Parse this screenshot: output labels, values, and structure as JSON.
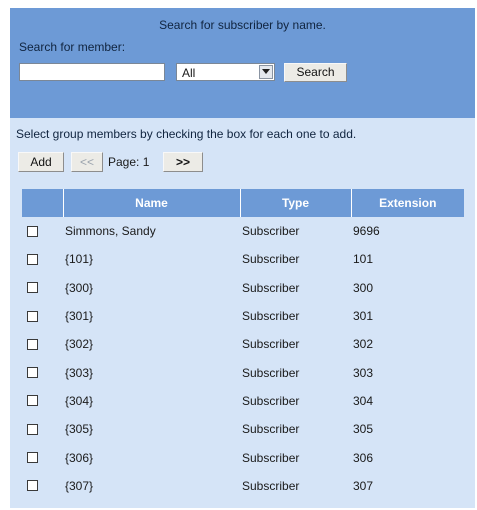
{
  "search": {
    "title": "Search for subscriber by name.",
    "label": "Search for member:",
    "input_value": "",
    "select_value": "All",
    "button_label": "Search"
  },
  "instruction": "Select group members by checking the box for each one to add.",
  "pager": {
    "add_label": "Add",
    "prev_label": "<<",
    "page_text": "Page: 1",
    "next_label": ">>"
  },
  "table": {
    "headers": [
      "",
      "Name",
      "Type",
      "Extension"
    ],
    "rows": [
      {
        "checked": false,
        "name": "Simmons, Sandy",
        "type": "Subscriber",
        "extension": "9696"
      },
      {
        "checked": false,
        "name": "{101}",
        "type": "Subscriber",
        "extension": "101"
      },
      {
        "checked": false,
        "name": "{300}",
        "type": "Subscriber",
        "extension": "300"
      },
      {
        "checked": false,
        "name": "{301}",
        "type": "Subscriber",
        "extension": "301"
      },
      {
        "checked": false,
        "name": "{302}",
        "type": "Subscriber",
        "extension": "302"
      },
      {
        "checked": false,
        "name": "{303}",
        "type": "Subscriber",
        "extension": "303"
      },
      {
        "checked": false,
        "name": "{304}",
        "type": "Subscriber",
        "extension": "304"
      },
      {
        "checked": false,
        "name": "{305}",
        "type": "Subscriber",
        "extension": "305"
      },
      {
        "checked": false,
        "name": "{306}",
        "type": "Subscriber",
        "extension": "306"
      },
      {
        "checked": false,
        "name": "{307}",
        "type": "Subscriber",
        "extension": "307"
      }
    ]
  },
  "colors": {
    "header_blue": "#6d9ad6",
    "panel_light_blue": "#d5e4f7"
  },
  "icons": {
    "select_arrow": "chevron-down-icon"
  }
}
